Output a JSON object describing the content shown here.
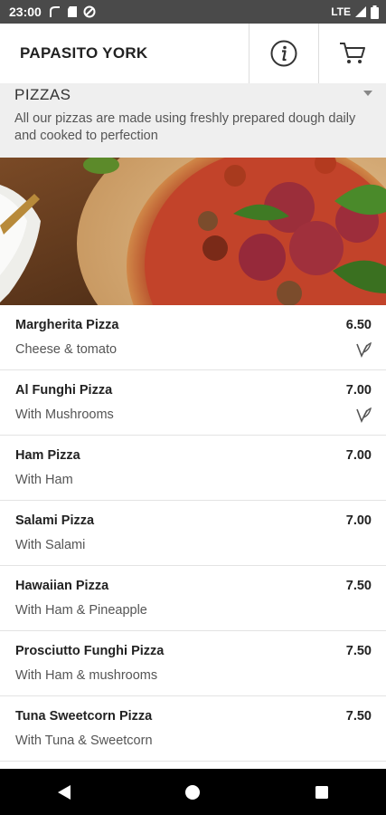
{
  "status_bar": {
    "time": "23:00",
    "network": "LTE"
  },
  "header": {
    "title": "PAPASITO YORK",
    "icons": [
      "info-icon",
      "cart-icon"
    ]
  },
  "section": {
    "title": "PIZZAS",
    "description": "All our pizzas are made using freshly prepared dough daily and cooked to perfection"
  },
  "menu": {
    "items": [
      {
        "name": "Margherita Pizza",
        "price": "6.50",
        "description": "Cheese & tomato",
        "vegetarian": true
      },
      {
        "name": "Al Funghi Pizza",
        "price": "7.00",
        "description": "With Mushrooms",
        "vegetarian": true
      },
      {
        "name": "Ham Pizza",
        "price": "7.00",
        "description": "With Ham",
        "vegetarian": false
      },
      {
        "name": "Salami Pizza",
        "price": "7.00",
        "description": "With Salami",
        "vegetarian": false
      },
      {
        "name": "Hawaiian Pizza",
        "price": "7.50",
        "description": "With Ham & Pineapple",
        "vegetarian": false
      },
      {
        "name": "Prosciutto Funghi Pizza",
        "price": "7.50",
        "description": "With Ham & mushrooms",
        "vegetarian": false
      },
      {
        "name": "Tuna Sweetcorn Pizza",
        "price": "7.50",
        "description": "With Tuna & Sweetcorn",
        "vegetarian": false
      }
    ]
  },
  "nav": {
    "buttons": [
      "back-icon",
      "home-icon",
      "recents-icon"
    ]
  }
}
